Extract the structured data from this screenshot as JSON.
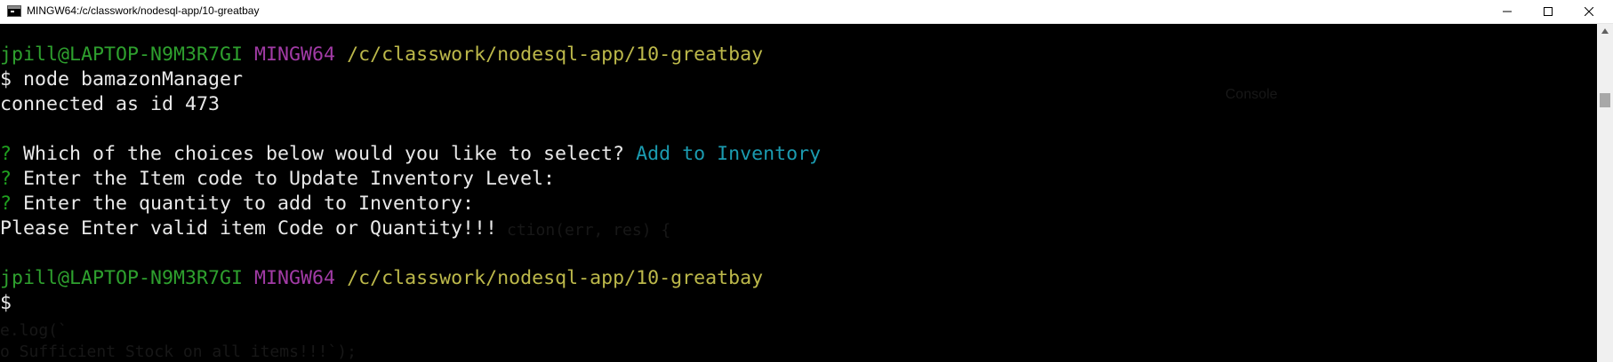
{
  "window": {
    "title": "MINGW64:/c/classwork/nodesql-app/10-greatbay"
  },
  "icons": {
    "app": "terminal-icon",
    "minimize": "minimize-icon",
    "maximize": "maximize-icon",
    "close": "close-icon",
    "scroll_up": "scroll-up-arrow-icon"
  },
  "colors": {
    "user_host": "#2ea02e",
    "mingw": "#a23ba6",
    "path": "#bcb84a",
    "question_mark": "#1fa01f",
    "answer": "#1b9bb0",
    "text": "#e6e6e6",
    "background": "#000000"
  },
  "terminal": {
    "prompt1": {
      "user_host": "jpill@LAPTOP-N9M3R7GI",
      "system": "MINGW64",
      "path": "/c/classwork/nodesql-app/10-greatbay"
    },
    "command_line": "$ node bamazonManager",
    "connected_line": "connected as id 473",
    "questions": [
      {
        "mark": "?",
        "text": "Which of the choices below would you like to select?",
        "answer": "Add to Inventory"
      },
      {
        "mark": "?",
        "text": "Enter the Item code to Update Inventory Level:",
        "answer": ""
      },
      {
        "mark": "?",
        "text": "Enter the quantity to add to Inventory:",
        "answer": ""
      }
    ],
    "error_line": "Please Enter valid item Code or Quantity!!!",
    "prompt2": {
      "user_host": "jpill@LAPTOP-N9M3R7GI",
      "system": "MINGW64",
      "path": "/c/classwork/nodesql-app/10-greatbay"
    },
    "cursor_line": "$",
    "background_ghost": {
      "console_tab": "Console",
      "code_fragment": "ction(err, res) {",
      "line_a": "e.log(`",
      "line_b": "o Sufficient Stock on all items!!!`);"
    }
  }
}
